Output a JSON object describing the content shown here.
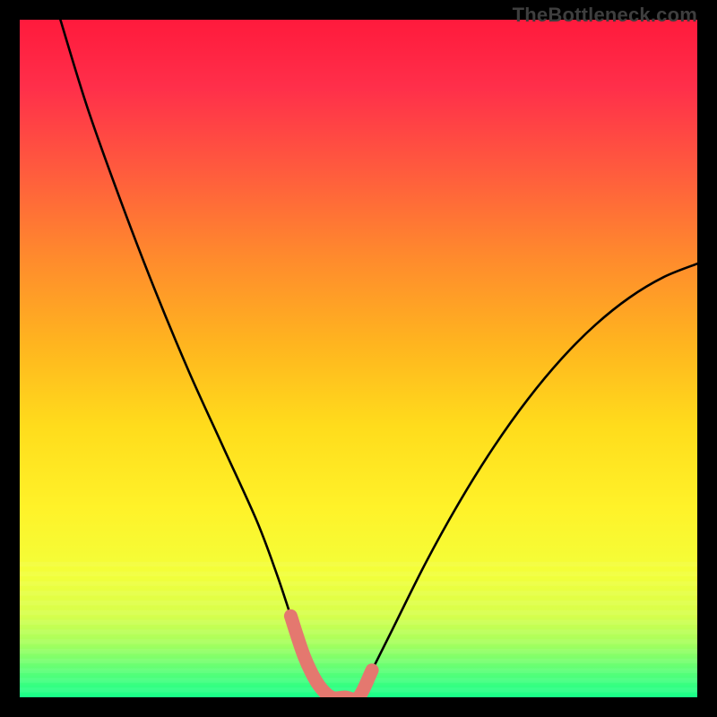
{
  "watermark": {
    "text": "TheBottleneck.com"
  },
  "chart_data": {
    "type": "line",
    "title": "",
    "xlabel": "",
    "ylabel": "",
    "xlim": [
      0,
      100
    ],
    "ylim": [
      0,
      100
    ],
    "grid": false,
    "notes": "V-shaped bottleneck curve over a vertical rainbow gradient. Y represents bottleneck percentage (0 at bottom/green, 100 at top/red). The minimum (optimal point) lies around x≈42–50, highlighted by a short salmon segment. Axes are unlabeled in the image.",
    "series": [
      {
        "name": "bottleneck-curve",
        "color": "#000000",
        "x": [
          6,
          10,
          15,
          20,
          25,
          30,
          35,
          38,
          40,
          42,
          44,
          46,
          48,
          50,
          52,
          55,
          60,
          65,
          70,
          75,
          80,
          85,
          90,
          95,
          100
        ],
        "y": [
          100,
          87,
          73,
          60,
          48,
          37,
          26,
          18,
          12,
          6,
          2,
          0,
          0,
          0,
          4,
          10,
          20,
          29,
          37,
          44,
          50,
          55,
          59,
          62,
          64
        ]
      },
      {
        "name": "optimal-range-highlight",
        "color": "#e4786f",
        "x": [
          40,
          42,
          44,
          46,
          48,
          50,
          52
        ],
        "y": [
          12,
          6,
          2,
          0,
          0,
          0,
          4
        ]
      }
    ],
    "gradient_stops": [
      {
        "offset": 0.0,
        "color": "#ff1a3c"
      },
      {
        "offset": 0.1,
        "color": "#ff2f4a"
      },
      {
        "offset": 0.22,
        "color": "#ff5a3e"
      },
      {
        "offset": 0.35,
        "color": "#ff8a2d"
      },
      {
        "offset": 0.48,
        "color": "#ffb51f"
      },
      {
        "offset": 0.6,
        "color": "#ffdc1c"
      },
      {
        "offset": 0.72,
        "color": "#fff229"
      },
      {
        "offset": 0.82,
        "color": "#f2ff3a"
      },
      {
        "offset": 0.88,
        "color": "#d6ff4d"
      },
      {
        "offset": 0.92,
        "color": "#a7ff5d"
      },
      {
        "offset": 0.96,
        "color": "#5dff76"
      },
      {
        "offset": 1.0,
        "color": "#17ff8a"
      }
    ]
  }
}
